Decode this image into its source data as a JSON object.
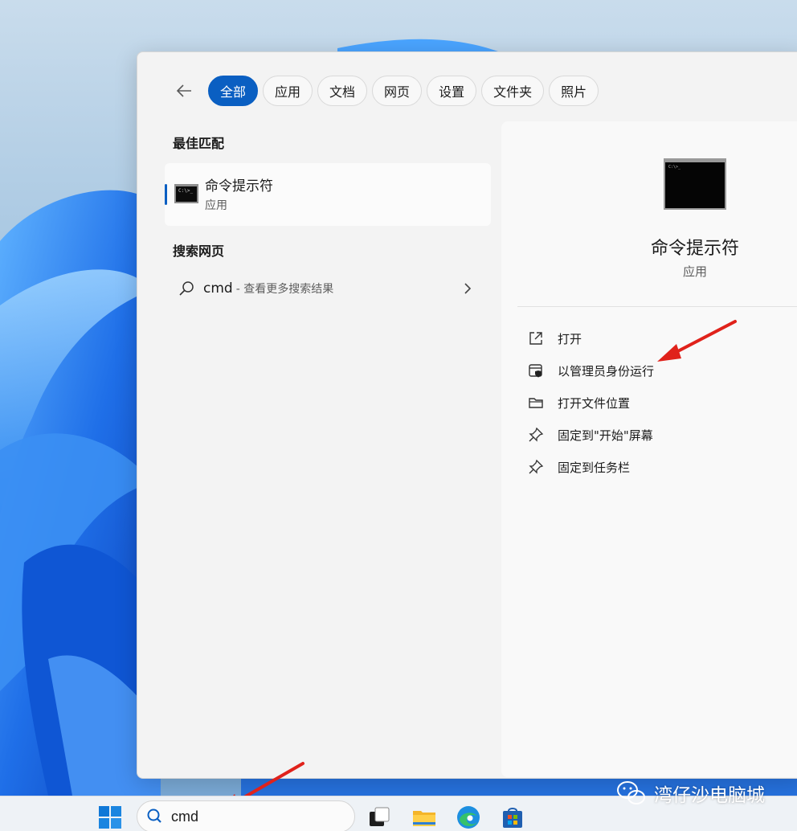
{
  "tabs": {
    "back_icon": "arrow-left-icon",
    "items": [
      {
        "label": "全部",
        "active": true
      },
      {
        "label": "应用"
      },
      {
        "label": "文档"
      },
      {
        "label": "网页"
      },
      {
        "label": "设置"
      },
      {
        "label": "文件夹"
      },
      {
        "label": "照片"
      }
    ]
  },
  "best_match": {
    "heading": "最佳匹配",
    "title": "命令提示符",
    "subtitle": "应用",
    "icon_text": "C:\\>_"
  },
  "web_search": {
    "heading": "搜索网页",
    "query": "cmd",
    "hint": "- 查看更多搜索结果"
  },
  "detail": {
    "title": "命令提示符",
    "subtitle": "应用",
    "actions": [
      {
        "label": "打开",
        "icon": "external-open-icon"
      },
      {
        "label": "以管理员身份运行",
        "icon": "admin-shield-icon"
      },
      {
        "label": "打开文件位置",
        "icon": "folder-icon"
      },
      {
        "label": "固定到\"开始\"屏幕",
        "icon": "pin-icon"
      },
      {
        "label": "固定到任务栏",
        "icon": "pin-icon"
      }
    ]
  },
  "taskbar": {
    "search_value": "cmd"
  },
  "watermark": {
    "text": "湾仔沙电脑城"
  },
  "colors": {
    "accent": "#0a5fc2",
    "annotation_arrow": "#e0221b"
  }
}
